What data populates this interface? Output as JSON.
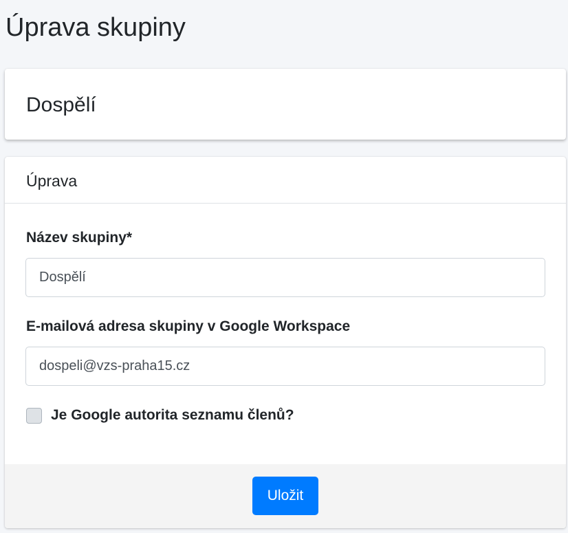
{
  "page": {
    "title": "Úprava skupiny"
  },
  "group": {
    "name": "Dospělí"
  },
  "edit_card": {
    "header": "Úprava",
    "fields": {
      "name_label": "Název skupiny*",
      "name_value": "Dospělí",
      "email_label": "E-mailová adresa skupiny v Google Workspace",
      "email_value": "dospeli@vzs-praha15.cz",
      "checkbox_label": "Je Google autorita seznamu členů?",
      "checkbox_checked": false
    },
    "save_label": "Uložit"
  },
  "colors": {
    "primary": "#007bff",
    "background": "#f4f6f9",
    "footer": "#f4f4f4"
  }
}
